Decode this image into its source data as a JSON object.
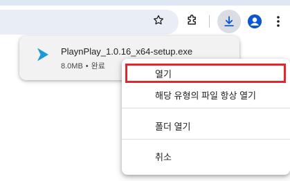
{
  "toolbar": {
    "bookmark_icon": "star-outline-icon",
    "extensions_icon": "puzzle-piece-icon",
    "downloads_icon": "download-arrow-icon",
    "profile_icon": "person-icon",
    "menu_icon": "three-dots-vertical-icon",
    "accent_color": "#0b57d0"
  },
  "download": {
    "filename": "PlaynPlay_1.0.16_x64-setup.exe",
    "size": "8.0MB",
    "separator": "•",
    "status": "완료",
    "file_icon": "play-triangle-icon",
    "file_icon_color": "#1a9bd7"
  },
  "context_menu": {
    "open_label": "열기",
    "always_open_label": "해당 유형의 파일 항상 열기",
    "show_in_folder_label": "폴더 열기",
    "cancel_label": "취소",
    "highlight_color": "#e32530"
  }
}
